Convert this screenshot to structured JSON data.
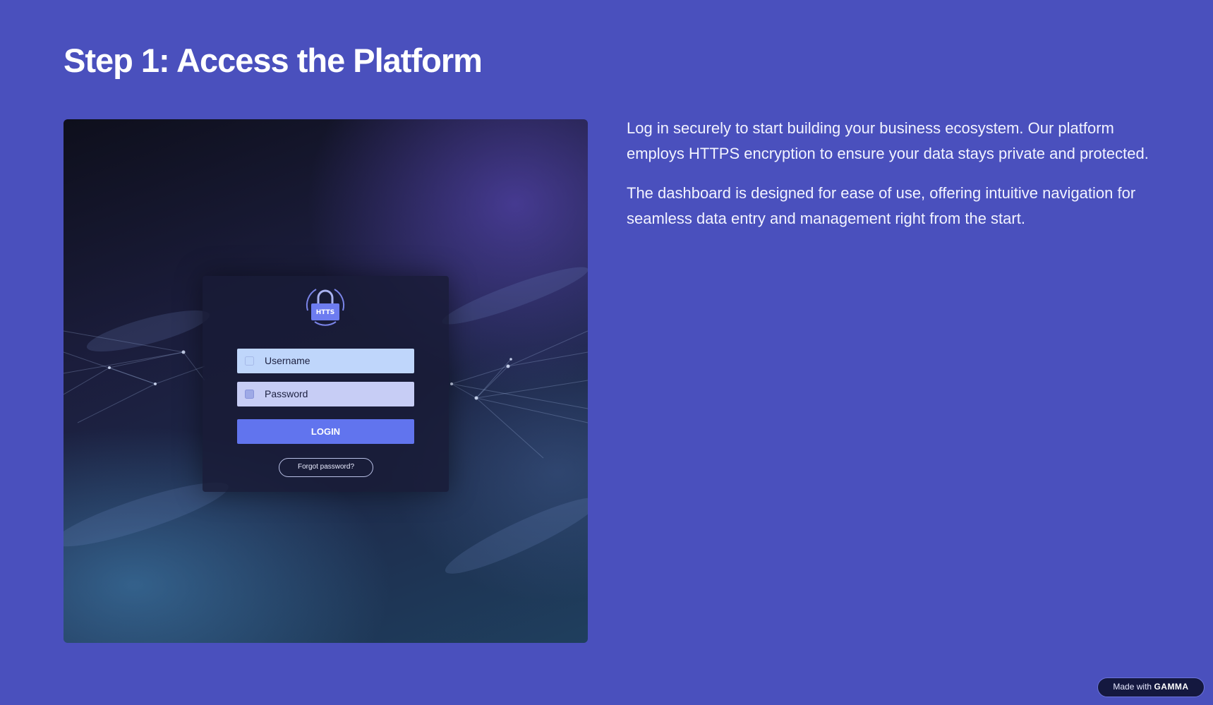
{
  "page": {
    "title": "Step 1: Access the Platform",
    "paragraphs": [
      "Log in securely to start building your business ecosystem. Our platform employs HTTPS encryption to ensure your data stays private and protected.",
      "The dashboard is designed for ease of use, offering intuitive navigation for seamless data entry and management right from the start."
    ]
  },
  "login": {
    "lock_label": "HTTS",
    "username_placeholder": "Username",
    "password_placeholder": "Password",
    "login_label": "LOGIN",
    "forgot_label": "Forgot password?"
  },
  "badge": {
    "prefix": "Made with",
    "brand": "GAMMA"
  },
  "icons": {
    "lock": "lock-icon",
    "user": "user-icon",
    "key": "password-icon"
  },
  "colors": {
    "background": "#4a50bd",
    "button": "#6174ee",
    "text": "#ffffff"
  }
}
